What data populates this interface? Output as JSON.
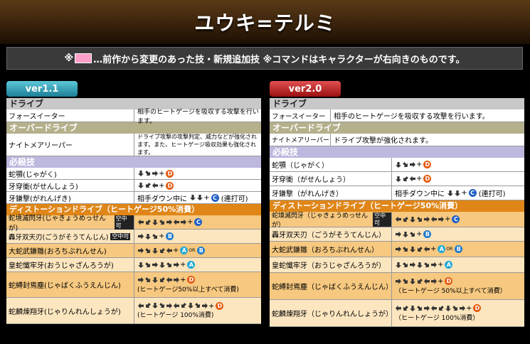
{
  "title": "ユウキ=テルミ",
  "notice": {
    "prefix": "※",
    "text": "…前作から変更のあった技・新規追加技 ※コマンドはキャラクターが右向きのものです。",
    "highlight_color": "#ff9ec8"
  },
  "versions": {
    "v1": "ver1.1",
    "v2": "ver2.0"
  },
  "sections": {
    "drive": "ドライブ",
    "overdrive": "オーバードライブ",
    "special": "必殺技",
    "distortion": "ディストーションドライブ（ヒートゲージ50%消費）"
  },
  "v1": {
    "drive_name": "フォースイーター",
    "drive_desc": "相手のヒートゲージを吸収する攻撃を行います。",
    "od_name": "ナイトメアリーパー",
    "od_desc": "ドライブ攻撃の攻撃判定、威力などが強化されます。また、ヒートゲージ吸収効果も強化されます。",
    "specials": [
      {
        "name": "蛇顎(じゃがく)"
      },
      {
        "name": "牙穿衝(がせんしょう)"
      },
      {
        "name": "牙鎌撃(がれんげき)",
        "note": "相手ダウン中に",
        "tail": "(連打可)"
      }
    ],
    "distortions": [
      {
        "name": "蛇境滅閃牙(じゃきょうめっせんが)",
        "tag": "空中可"
      },
      {
        "name": "轟牙双天刃(ごうがそうてんじん)",
        "tag": "空中可"
      },
      {
        "name": "大蛇武鎌雛(おろちぶれんせん)"
      },
      {
        "name": "皇蛇懺牢牙(おうじゃざんろうが)"
      },
      {
        "name": "蛇縛封焉塵(じゃばくふうえんじん)",
        "sub": "(ヒートゲージ50%以上すべて消費)"
      },
      {
        "name": "蛇麟煉翔牙(じゃりんれんしょうが)",
        "sub": "(ヒートゲージ 100%消費)"
      }
    ]
  },
  "v2": {
    "drive_name": "フォースイーター",
    "drive_desc": "相手のヒートゲージを吸収する攻撃を行います。",
    "od_name": "ナイトメアリーパー",
    "od_desc": "ドライブ攻撃が強化されます。",
    "specials": [
      {
        "name": "蛇顎（じゃがく）"
      },
      {
        "name": "牙穿衝（がせんしょう）"
      },
      {
        "name": "牙鎌撃（がれんげき）",
        "note": "相手ダウン中に",
        "tail": "(連打可)"
      }
    ],
    "distortions": [
      {
        "name": "蛇境滅閃牙（じゃきょうめっせんが）",
        "tag": "空中可"
      },
      {
        "name": "轟牙双天刃（ごうがそうてんじん）"
      },
      {
        "name": "大蛇武鎌雛（おろちぶれんせん）"
      },
      {
        "name": "皇蛇懺牢牙（おうじゃざんろうが）"
      },
      {
        "name": "蛇縛封焉塵（じゃばくふうえんじん）",
        "sub": "（ヒートゲージ 50%以上すべて消費）"
      },
      {
        "name": "蛇麟煉翔牙（じゃりんれんしょうが）",
        "sub": "（ヒートゲージ 100%消費）"
      }
    ]
  },
  "buttons": {
    "d": "D",
    "c": "C",
    "b": "B",
    "a": "A",
    "or": "OR"
  },
  "colors": {
    "drive": "#e55a10",
    "c": "#1f5fc4",
    "b": "#1f7ac9",
    "a": "#1fa9d6"
  }
}
